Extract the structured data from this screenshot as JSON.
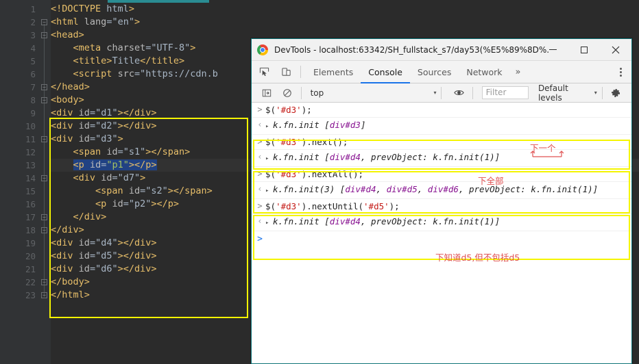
{
  "editor": {
    "language": "html",
    "lines": [
      {
        "n": "1",
        "indent": 0,
        "text": "<!DOCTYPE html>"
      },
      {
        "n": "2",
        "indent": 0,
        "text": "<html lang=\"en\">"
      },
      {
        "n": "3",
        "indent": 0,
        "text": "<head>"
      },
      {
        "n": "4",
        "indent": 1,
        "text": "<meta charset=\"UTF-8\">"
      },
      {
        "n": "5",
        "indent": 1,
        "text": "<title>Title</title>"
      },
      {
        "n": "6",
        "indent": 1,
        "text": "<script src=\"https://cdn.b"
      },
      {
        "n": "7",
        "indent": 0,
        "text": "</head>"
      },
      {
        "n": "8",
        "indent": 0,
        "text": "<body>"
      },
      {
        "n": "9",
        "indent": 0,
        "text": "<div id=\"d1\"></div>"
      },
      {
        "n": "10",
        "indent": 0,
        "text": "<div id=\"d2\"></div>"
      },
      {
        "n": "11",
        "indent": 0,
        "text": "<div id=\"d3\">"
      },
      {
        "n": "12",
        "indent": 1,
        "text": "<span id=\"s1\"></span>"
      },
      {
        "n": "13",
        "indent": 1,
        "text": "<p id=\"p1\"></p>"
      },
      {
        "n": "14",
        "indent": 1,
        "text": "<div id=\"d7\">"
      },
      {
        "n": "15",
        "indent": 2,
        "text": "<span id=\"s2\"></span>"
      },
      {
        "n": "16",
        "indent": 2,
        "text": "<p id=\"p2\"></p>"
      },
      {
        "n": "17",
        "indent": 1,
        "text": "</div>"
      },
      {
        "n": "18",
        "indent": 0,
        "text": "</div>"
      },
      {
        "n": "19",
        "indent": 0,
        "text": "<div id=\"d4\"></div>"
      },
      {
        "n": "20",
        "indent": 0,
        "text": "<div id=\"d5\"></div>"
      },
      {
        "n": "21",
        "indent": 0,
        "text": "<div id=\"d6\"></div>"
      },
      {
        "n": "22",
        "indent": 0,
        "text": "</body>"
      },
      {
        "n": "23",
        "indent": 0,
        "text": "</html>"
      }
    ],
    "highlighted_line": "13",
    "colors": {
      "background": "#2b2b2b",
      "gutter": "#313335",
      "tag": "#e8bf6a",
      "attribute": "#bababa",
      "value": "#a5c261",
      "line_number": "#606366",
      "annotation_box": "#f5f500",
      "top_accent": "#2a8c92"
    }
  },
  "devtools": {
    "window": {
      "title": "DevTools - localhost:63342/SH_fullstack_s7/day53(%E5%89%8D%...",
      "minimize_label": "—",
      "maximize_label": "□",
      "close_label": "✕"
    },
    "toolbar_icons": {
      "inspect": "inspect-element-icon",
      "device": "device-toolbar-icon"
    },
    "tabs": [
      {
        "label": "Elements",
        "active": false
      },
      {
        "label": "Console",
        "active": true
      },
      {
        "label": "Sources",
        "active": false
      },
      {
        "label": "Network",
        "active": false
      }
    ],
    "more_tabs_label": "»",
    "kebab_label": "more-options",
    "console_toolbar": {
      "sidebar_toggle": "console-sidebar-icon",
      "clear_label": "clear-console-icon",
      "context": "top",
      "context_caret": "▾",
      "eye_label": "live-expression-icon",
      "filter_placeholder": "Filter",
      "filter_value": "",
      "levels_label": "Default levels",
      "levels_caret": "▾",
      "settings_label": "console-settings-icon"
    },
    "console_entries": [
      {
        "type": "input",
        "marker": ">",
        "code_prefix": "$(",
        "code_str": "'#d3'",
        "code_suffix": ");",
        "boxed": false
      },
      {
        "type": "output",
        "marker": "‹",
        "disclosure": "▸",
        "result_prefix": "k.fn.init [",
        "result_nodes": [
          "div#d3"
        ],
        "result_suffix": "]",
        "boxed": false
      },
      {
        "type": "input",
        "marker": ">",
        "code_prefix": "$(",
        "code_str": "'#d3'",
        "code_suffix": ").next();",
        "boxed": true
      },
      {
        "type": "output",
        "marker": "‹",
        "disclosure": "▸",
        "result_prefix": "k.fn.init [",
        "result_nodes": [
          "div#d4"
        ],
        "result_suffix": ", prevObject: k.fn.init(1)]",
        "boxed": true
      },
      {
        "type": "input",
        "marker": ">",
        "code_prefix": "$(",
        "code_str": "'#d3'",
        "code_suffix": ").nextAll();",
        "boxed": true
      },
      {
        "type": "output",
        "marker": "‹",
        "disclosure": "▸",
        "result_prefix": "k.fn.init(3) [",
        "result_nodes": [
          "div#d4",
          "div#d5",
          "div#d6"
        ],
        "result_suffix": ", prevObject: k.fn.init(1)]",
        "boxed": true
      },
      {
        "type": "input",
        "marker": ">",
        "code_prefix": "$(",
        "code_str": "'#d3'",
        "code_suffix": ").nextUntil(",
        "code_str2": "'#d5'",
        "code_suffix2": ");",
        "boxed": true
      },
      {
        "type": "output",
        "marker": "‹",
        "disclosure": "▸",
        "result_prefix": "k.fn.init [",
        "result_nodes": [
          "div#d4"
        ],
        "result_suffix": ", prevObject: k.fn.init(1)]",
        "boxed": true
      }
    ],
    "prompt": {
      "caret": ">",
      "value": ""
    },
    "annotations": [
      {
        "id": "ann-next",
        "text": "下一个",
        "color": "#e05050"
      },
      {
        "id": "ann-nextall",
        "text": "下全部",
        "color": "#e05050"
      },
      {
        "id": "ann-nextuntil",
        "text": "下知道d5,但不包括d5",
        "color": "#e05050"
      }
    ]
  }
}
